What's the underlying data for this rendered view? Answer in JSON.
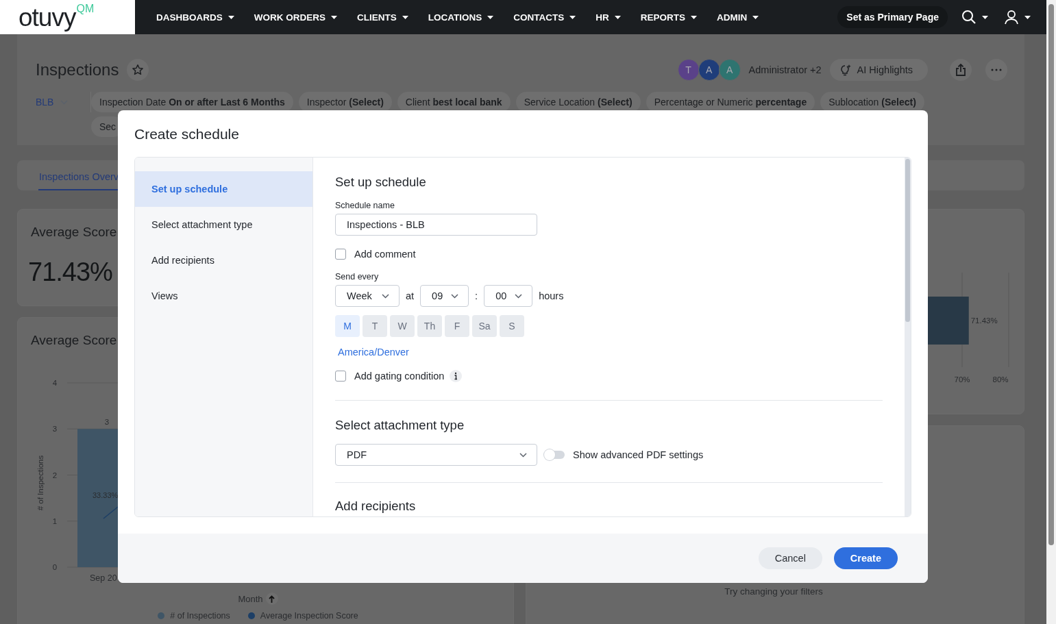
{
  "nav": {
    "logo": {
      "name": "otuvy",
      "suffix": "QM"
    },
    "menus": [
      {
        "label": "DASHBOARDS"
      },
      {
        "label": "WORK ORDERS"
      },
      {
        "label": "CLIENTS"
      },
      {
        "label": "LOCATIONS"
      },
      {
        "label": "CONTACTS"
      },
      {
        "label": "HR"
      },
      {
        "label": "REPORTS"
      },
      {
        "label": "ADMIN"
      }
    ],
    "primary_button": "Set as Primary Page"
  },
  "page": {
    "title": "Inspections",
    "favorite": false,
    "viewers": [
      {
        "initial": "T",
        "color": "#5a4189"
      },
      {
        "initial": "A",
        "color": "#1f3d7a"
      },
      {
        "initial": "A",
        "color": "#2e7470"
      }
    ],
    "viewers_label": "Administrator +2",
    "ai_button": "AI Highlights",
    "scope": "BLB",
    "filters": [
      {
        "text": "Inspection Date **On or after Last 6 Months**"
      },
      {
        "text": "Inspector **(Select)**"
      },
      {
        "text": "Client **best local bank**"
      },
      {
        "text": "Service Location **(Select)**"
      },
      {
        "text": "Percentage or Numeric **percentage**"
      },
      {
        "text": "Sublocation **(Select)**"
      },
      {
        "text": "Sec"
      }
    ],
    "tabs": [
      {
        "label": "Inspections Overv",
        "selected": true
      }
    ]
  },
  "cards": {
    "score": {
      "title": "Average Score",
      "value": "71.43%"
    },
    "trend": {
      "title": "Average Score",
      "point_label": "33.33%",
      "chart_data": {
        "type": "bar",
        "xlabel": "Month",
        "ylabel": "# of Inspections",
        "categories": [
          "Sep 20"
        ],
        "yticks": [
          0,
          1,
          2,
          3,
          4
        ],
        "ylim": [
          0,
          4
        ],
        "grid": true,
        "data_labels": true,
        "series": [
          {
            "name": "# of Inspections",
            "color": "#3f5566",
            "values": [
              3
            ]
          }
        ]
      },
      "extra_legend": [
        {
          "label": "Average Inspection Score",
          "color": "#1d3f66"
        }
      ]
    },
    "distribution": {
      "chart_data": {
        "type": "bar",
        "orientation": "horizontal",
        "values": [
          71.43
        ],
        "xlim": [
          70,
          80
        ],
        "xticks": [
          {
            "value": 70,
            "label": "70%"
          },
          {
            "value": 80,
            "label": "80%"
          }
        ],
        "value_labels": [
          "71.43%"
        ]
      }
    },
    "empty": {
      "message": "Try changing your filters"
    }
  },
  "modal": {
    "title": "Create schedule",
    "steps": [
      {
        "label": "Set up schedule",
        "selected": true
      },
      {
        "label": "Select attachment type",
        "selected": false
      },
      {
        "label": "Add recipients",
        "selected": false
      },
      {
        "label": "Views",
        "selected": false
      }
    ],
    "setup": {
      "heading": "Set up schedule",
      "name_label": "Schedule name",
      "name_value": "Inspections - BLB",
      "comment": {
        "label": "Add comment",
        "checked": false
      },
      "send_label": "Send every",
      "frequency": "Week",
      "at_label": "at",
      "hour": "09",
      "colon": ":",
      "minute": "00",
      "hours_label": "hours",
      "days": [
        {
          "label": "M",
          "selected": true
        },
        {
          "label": "T",
          "selected": false
        },
        {
          "label": "W",
          "selected": false
        },
        {
          "label": "Th",
          "selected": false
        },
        {
          "label": "F",
          "selected": false
        },
        {
          "label": "Sa",
          "selected": false
        },
        {
          "label": "S",
          "selected": false
        }
      ],
      "timezone": "America/Denver",
      "gating": {
        "label": "Add gating condition",
        "checked": false
      }
    },
    "attachment": {
      "heading": "Select attachment type",
      "type": "PDF",
      "advanced": {
        "label": "Show advanced PDF settings",
        "on": false
      }
    },
    "recipients": {
      "heading": "Add recipients"
    },
    "buttons": [
      {
        "label": "Cancel",
        "kind": "secondary"
      },
      {
        "label": "Create",
        "kind": "primary"
      }
    ]
  }
}
